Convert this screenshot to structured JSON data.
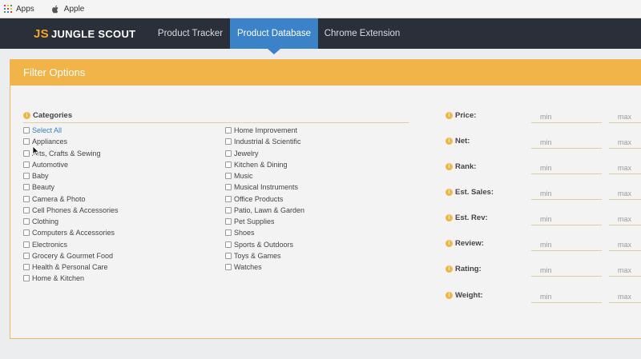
{
  "bookmarks": [
    {
      "label": "Apps",
      "icon": "apps-grid-icon"
    },
    {
      "label": "Apple",
      "icon": "apple-icon"
    }
  ],
  "nav": {
    "logo_mark": "JS",
    "logo_text": "JUNGLE SCOUT",
    "tabs": [
      {
        "label": "Product Tracker",
        "active": false
      },
      {
        "label": "Product Database",
        "active": true
      },
      {
        "label": "Chrome Extension",
        "active": false
      }
    ]
  },
  "panel": {
    "title": "Filter Options",
    "categories_heading": "Categories",
    "categories_col1": [
      "Select All",
      "Appliances",
      "Arts, Crafts & Sewing",
      "Automotive",
      "Baby",
      "Beauty",
      "Camera & Photo",
      "Cell Phones & Accessories",
      "Clothing",
      "Computers & Accessories",
      "Electronics",
      "Grocery & Gourmet Food",
      "Health & Personal Care",
      "Home & Kitchen"
    ],
    "categories_col2": [
      "Home Improvement",
      "Industrial & Scientific",
      "Jewelry",
      "Kitchen & Dining",
      "Music",
      "Musical Instruments",
      "Office Products",
      "Patio, Lawn & Garden",
      "Pet Supplies",
      "Shoes",
      "Sports & Outdoors",
      "Toys & Games",
      "Watches"
    ],
    "ranges": [
      {
        "label": "Price:",
        "min_placeholder": "min",
        "max_placeholder": "max"
      },
      {
        "label": "Net:",
        "min_placeholder": "min",
        "max_placeholder": "max"
      },
      {
        "label": "Rank:",
        "min_placeholder": "min",
        "max_placeholder": "max"
      },
      {
        "label": "Est. Sales:",
        "min_placeholder": "min",
        "max_placeholder": "max"
      },
      {
        "label": "Est. Rev:",
        "min_placeholder": "min",
        "max_placeholder": "max"
      },
      {
        "label": "Review:",
        "min_placeholder": "min",
        "max_placeholder": "max"
      },
      {
        "label": "Rating:",
        "min_placeholder": "min",
        "max_placeholder": "max"
      },
      {
        "label": "Weight:",
        "min_placeholder": "min",
        "max_placeholder": "max"
      }
    ],
    "info_glyph": "i"
  },
  "colors": {
    "nav_bg": "#2a2f3a",
    "nav_active": "#3c82c8",
    "accent_orange": "#f1b448",
    "link_blue": "#3b7fc4"
  }
}
